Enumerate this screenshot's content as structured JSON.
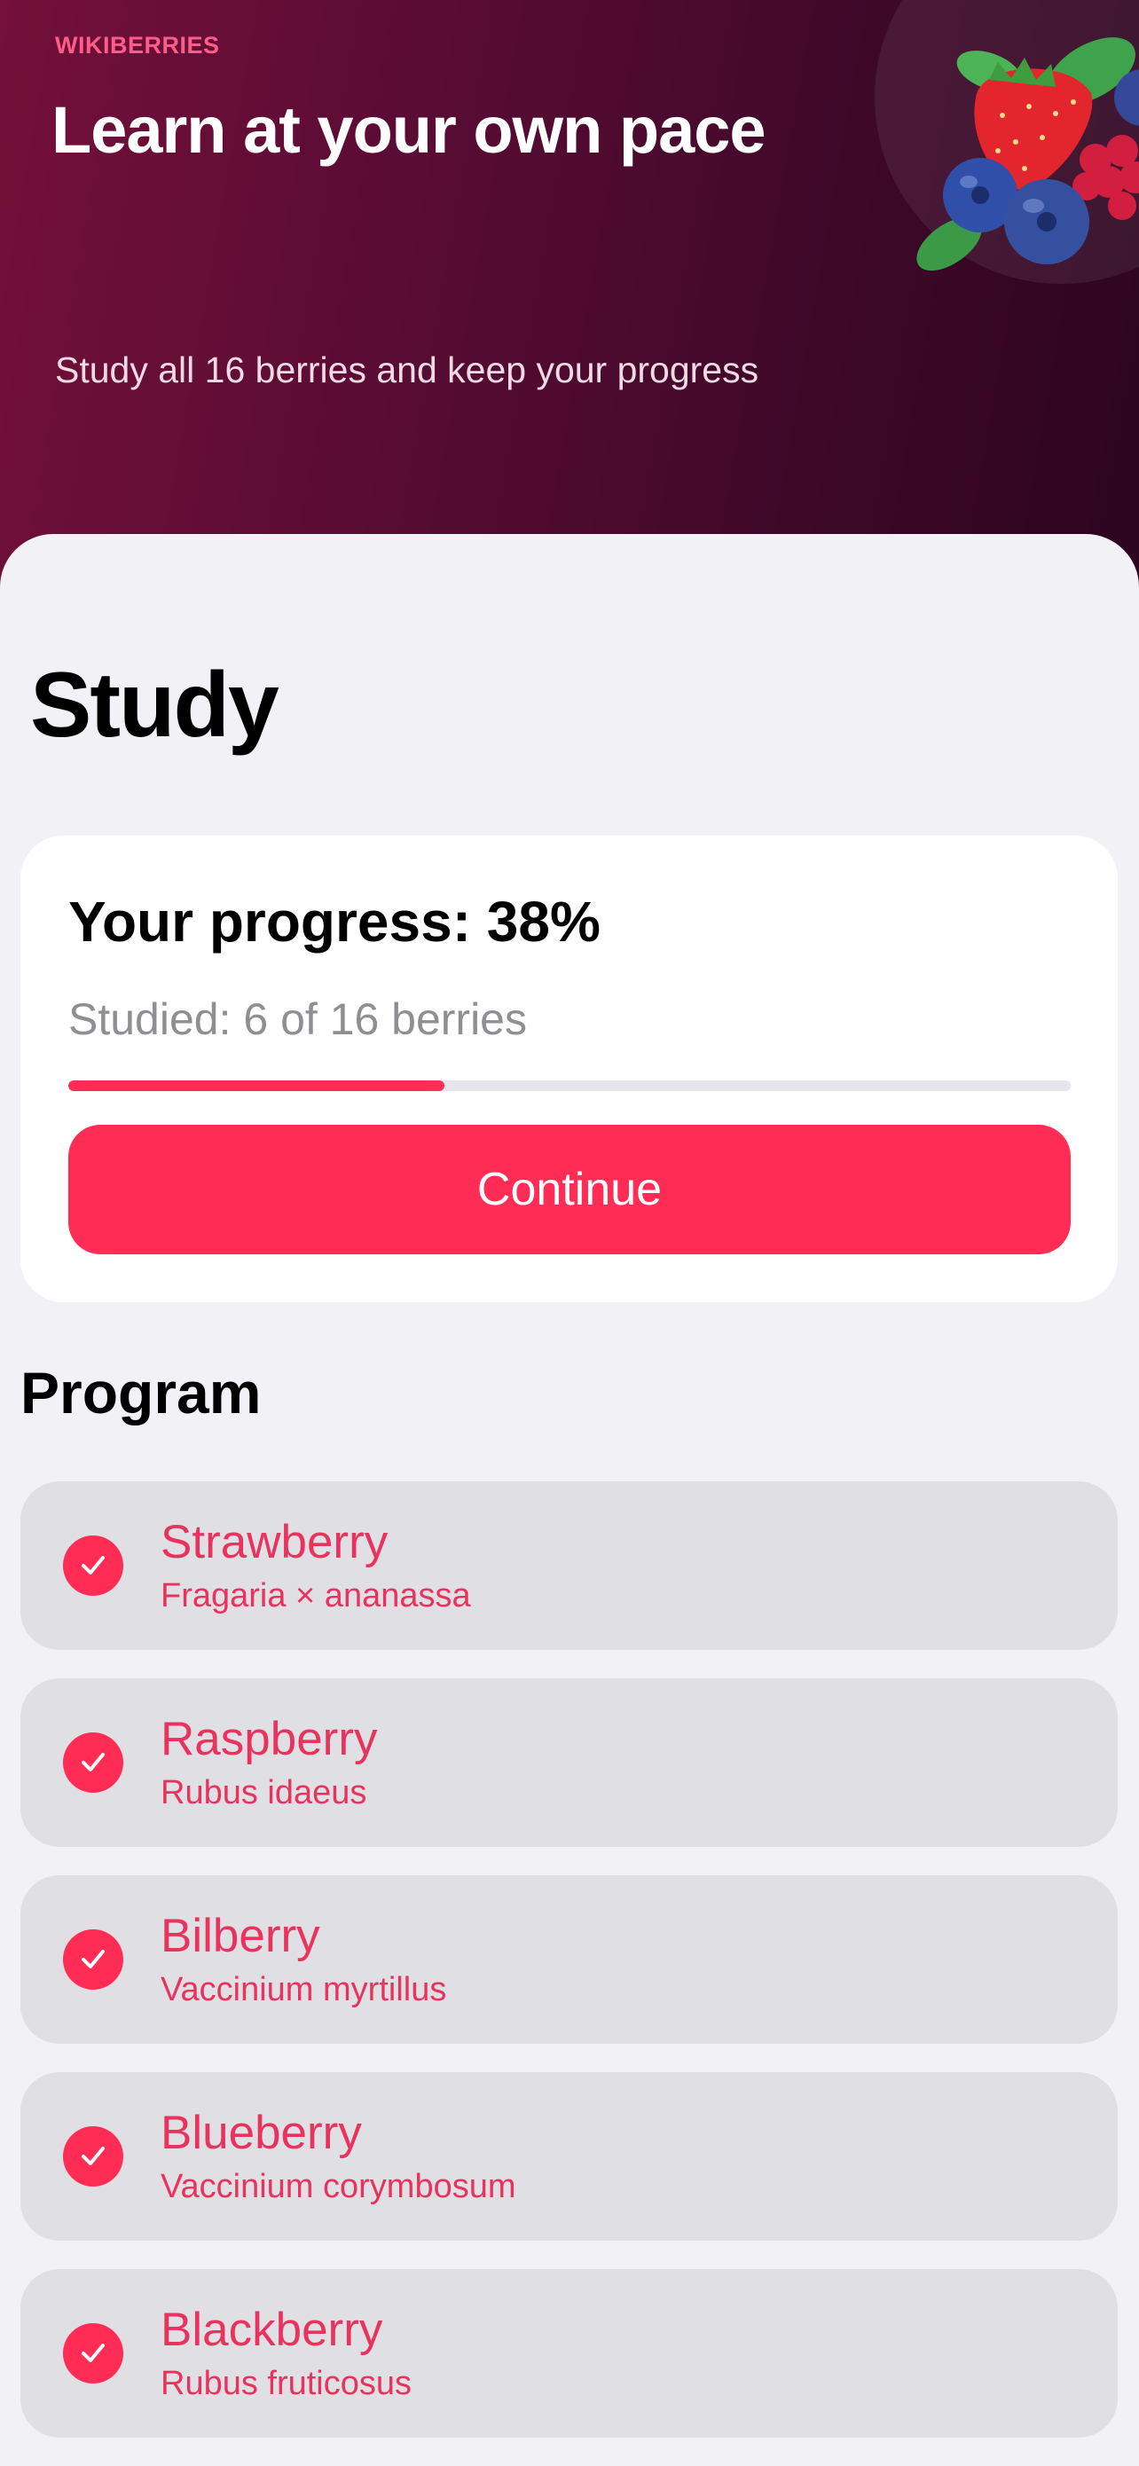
{
  "hero": {
    "brand": "WIKIBERRIES",
    "title": "Learn at your own pace",
    "subtitle": "Study all 16 berries and keep your progress",
    "illustration": "mixed-berries-illustration"
  },
  "study": {
    "title": "Study",
    "progress": {
      "title": "Your progress: 38%",
      "subtitle": "Studied: 6 of 16 berries",
      "fraction": 0.375,
      "continue_label": "Continue"
    }
  },
  "program": {
    "title": "Program",
    "items": [
      {
        "name": "Strawberry",
        "latin": "Fragaria × ananassa",
        "icon": "checkmark-circle-icon"
      },
      {
        "name": "Raspberry",
        "latin": "Rubus idaeus",
        "icon": "checkmark-circle-icon"
      },
      {
        "name": "Bilberry",
        "latin": "Vaccinium myrtillus",
        "icon": "checkmark-circle-icon"
      },
      {
        "name": "Blueberry",
        "latin": "Vaccinium corymbosum",
        "icon": "checkmark-circle-icon"
      },
      {
        "name": "Blackberry",
        "latin": "Rubus fruticosus",
        "icon": "checkmark-circle-icon"
      }
    ]
  },
  "colors": {
    "accent": "#ff2d55",
    "hero_start": "#741039",
    "hero_end": "#2c0520",
    "background": "#f2f1f6",
    "list_item": "#e0dfe4"
  }
}
